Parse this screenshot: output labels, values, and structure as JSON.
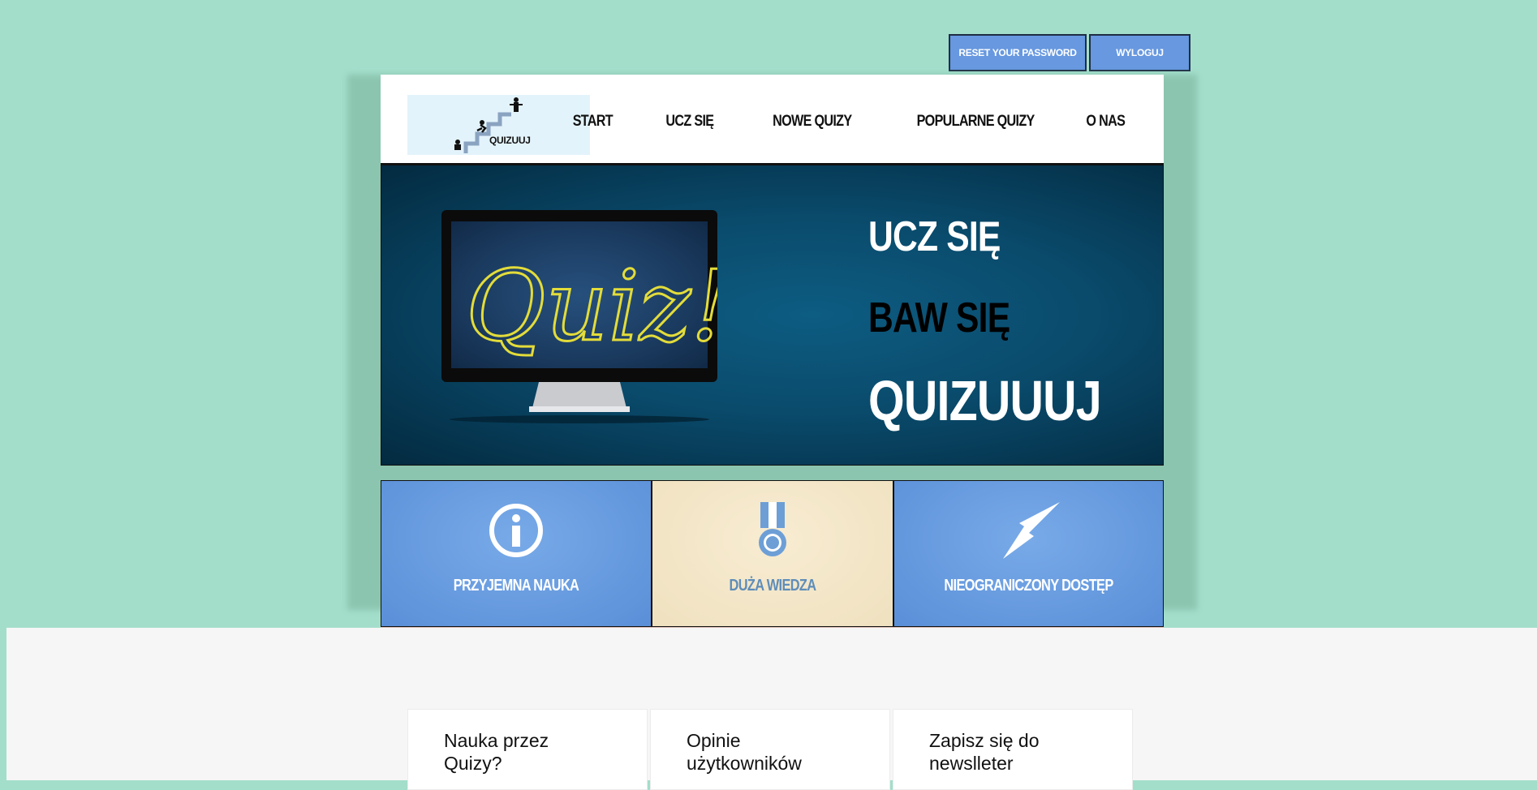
{
  "top_buttons": {
    "reset_password": "RESET YOUR PASSWORD",
    "logout": "WYLOGUJ"
  },
  "logo": {
    "text": "QUIZUUJ"
  },
  "nav": {
    "items": [
      "START",
      "UCZ SIĘ",
      "NOWE QUIZY",
      "POPULARNE QUIZY",
      "O NAS"
    ]
  },
  "hero": {
    "line1": "UCZ SIĘ",
    "line2": "BAW SIĘ",
    "line3": "QUIZUUUJ",
    "screen_text": "Quiz!"
  },
  "features": [
    {
      "label": "PRZYJEMNA NAUKA",
      "icon": "info-icon"
    },
    {
      "label": "DUŻA WIEDZA",
      "icon": "medal-icon"
    },
    {
      "label": "NIEOGRANICZONY DOSTĘP",
      "icon": "lightning-icon"
    }
  ],
  "cards": [
    {
      "title": "Nauka przez Quizy?"
    },
    {
      "title": "Opinie użytkowników"
    },
    {
      "title": "Zapisz się do newslleter"
    }
  ],
  "colors": {
    "background": "#a3decb",
    "button_blue": "#6798e0",
    "hero_dark": "#0a4b6c",
    "feature_blue": "#5a8fd8",
    "feature_cream": "#efe1bf"
  }
}
